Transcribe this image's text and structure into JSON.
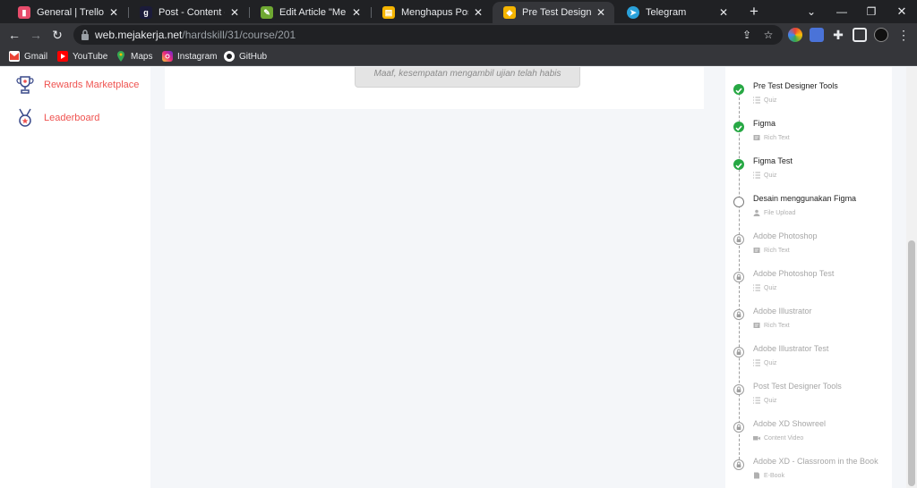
{
  "browser": {
    "tabs": [
      {
        "title": "General | Trello",
        "favicon": "trello-icon",
        "color": "#e74c6b",
        "active": false
      },
      {
        "title": "Post - Content - Graph",
        "favicon": "graphcms-icon",
        "color": "#1b1b3a",
        "active": false
      },
      {
        "title": "Edit Article \"Menu dan",
        "favicon": "edit-icon",
        "color": "#6fa832",
        "active": false
      },
      {
        "title": "Menghapus Postingan",
        "favicon": "article-icon",
        "color": "#f4b400",
        "active": false
      },
      {
        "title": "Pre Test Designer Tools",
        "favicon": "mejakerja-icon",
        "color": "#f4b400",
        "active": true
      },
      {
        "title": "Telegram",
        "favicon": "telegram-icon",
        "color": "#2aa1da",
        "active": false
      }
    ],
    "url_host": "web.mejakerja.net",
    "url_path": "/hardskill/31/course/201",
    "bookmarks": [
      {
        "label": "Gmail",
        "icon": "gmail-icon"
      },
      {
        "label": "YouTube",
        "icon": "youtube-icon"
      },
      {
        "label": "Maps",
        "icon": "maps-icon"
      },
      {
        "label": "Instagram",
        "icon": "instagram-icon"
      },
      {
        "label": "GitHub",
        "icon": "github-icon"
      }
    ]
  },
  "sidebar": {
    "items": [
      {
        "label": "Rewards Marketplace",
        "icon": "trophy-icon"
      },
      {
        "label": "Leaderboard",
        "icon": "medal-icon"
      }
    ],
    "accent": "#ef5350"
  },
  "main": {
    "exam_message": "Maaf, kesempatan mengambil ujian telah habis"
  },
  "course": {
    "lessons": [
      {
        "title": "Pre Test Designer Tools",
        "type": "Quiz",
        "status": "done"
      },
      {
        "title": "Figma",
        "type": "Rich Text",
        "status": "done"
      },
      {
        "title": "Figma Test",
        "type": "Quiz",
        "status": "done"
      },
      {
        "title": "Desain menggunakan Figma",
        "type": "File Upload",
        "status": "open"
      },
      {
        "title": "Adobe Photoshop",
        "type": "Rich Text",
        "status": "locked"
      },
      {
        "title": "Adobe Photoshop Test",
        "type": "Quiz",
        "status": "locked"
      },
      {
        "title": "Adobe Illustrator",
        "type": "Rich Text",
        "status": "locked"
      },
      {
        "title": "Adobe Illustrator Test",
        "type": "Quiz",
        "status": "locked"
      },
      {
        "title": "Post Test Designer Tools",
        "type": "Quiz",
        "status": "locked"
      },
      {
        "title": "Adobe XD Showreel",
        "type": "Content Video",
        "status": "locked"
      },
      {
        "title": "Adobe XD - Classroom in the Book",
        "type": "E-Book",
        "status": "locked"
      }
    ],
    "done_color": "#27a844"
  }
}
